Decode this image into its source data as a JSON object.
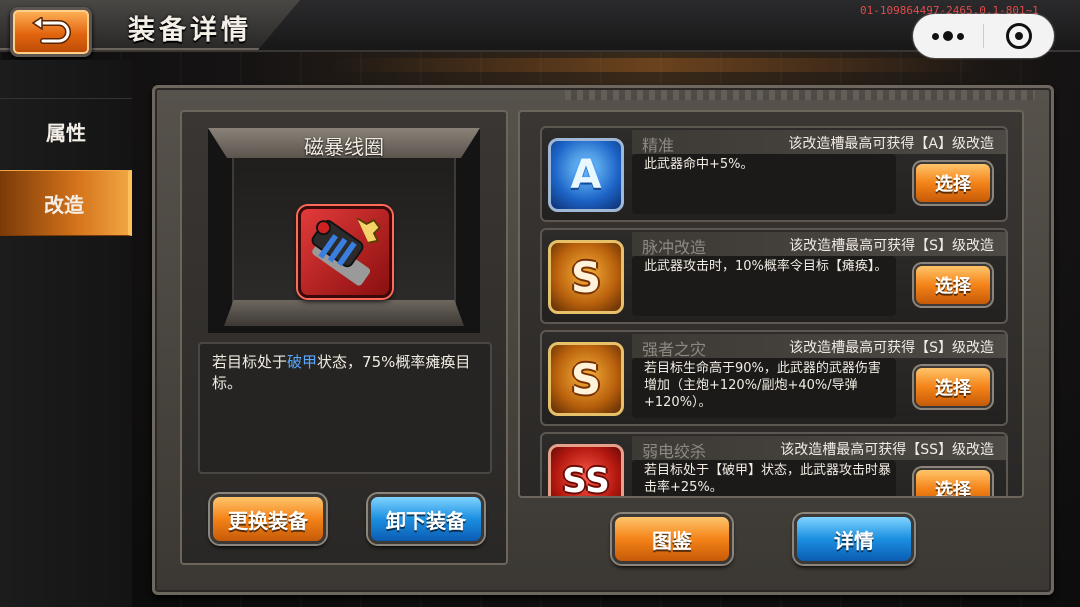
{
  "header": {
    "title": "装备详情",
    "build_id": "01-109864497-2465.0.1-801~1"
  },
  "nav": {
    "items": [
      {
        "label": "属性",
        "active": false
      },
      {
        "label": "改造",
        "active": true
      }
    ]
  },
  "equipment": {
    "name": "磁暴线圈",
    "desc_before": "若目标处于",
    "desc_highlight": "破甲",
    "desc_after": "状态，75%概率瘫痪目标。",
    "highlight_color": "#58a8ff",
    "icon": "tesla-coil-weapon-icon",
    "replace_label": "更换装备",
    "unequip_label": "卸下装备"
  },
  "slots": [
    {
      "grade": "A",
      "name": "精准",
      "cap": "该改造槽最高可获得【A】级改造",
      "desc": "此武器命中+5%。",
      "button": "选择"
    },
    {
      "grade": "S",
      "name": "脉冲改造",
      "cap": "该改造槽最高可获得【S】级改造",
      "desc": "此武器攻击时，10%概率令目标【瘫痪】。",
      "button": "选择"
    },
    {
      "grade": "S",
      "name": "强者之灾",
      "cap": "该改造槽最高可获得【S】级改造",
      "desc": "若目标生命高于90%，此武器的武器伤害增加（主炮+120%/副炮+40%/导弹+120%）。",
      "button": "选择"
    },
    {
      "grade": "SS",
      "name": "弱电绞杀",
      "cap": "该改造槽最高可获得【SS】级改造",
      "desc": "若目标处于【破甲】状态，此武器攻击时暴击率+25%。",
      "button": "选择"
    }
  ],
  "footer": {
    "catalog_label": "图鉴",
    "details_label": "详情"
  },
  "colors": {
    "accent_orange": "#f48318",
    "accent_blue": "#1b8fe0"
  }
}
